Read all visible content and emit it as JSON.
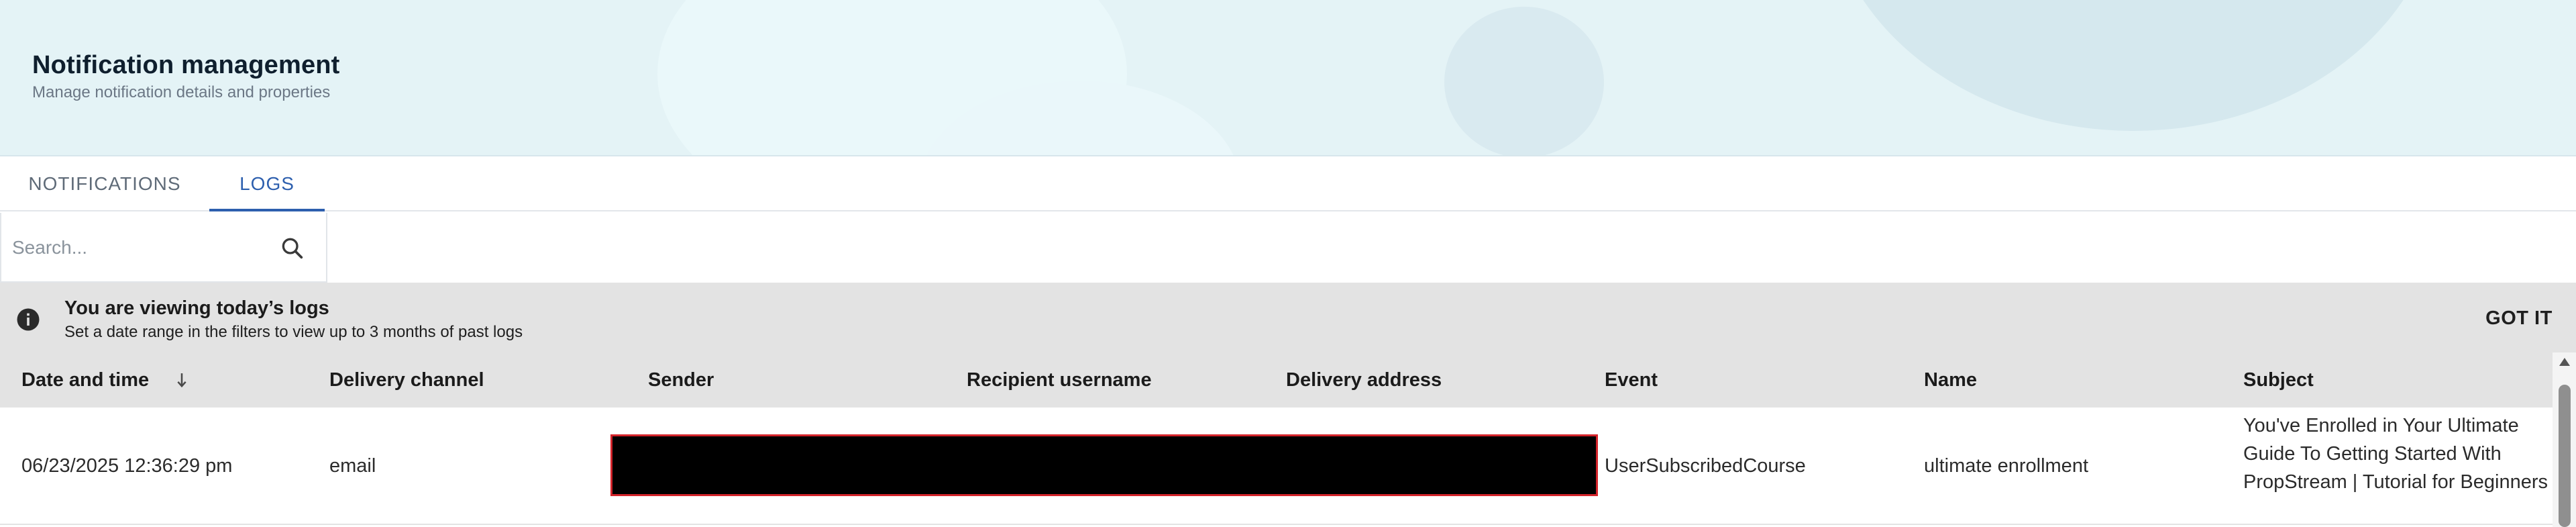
{
  "header": {
    "title": "Notification management",
    "subtitle": "Manage notification details and properties"
  },
  "tabs": [
    {
      "label": "NOTIFICATIONS",
      "active": false
    },
    {
      "label": "LOGS",
      "active": true
    }
  ],
  "search": {
    "placeholder": "Search...",
    "value": "",
    "icon": "search-icon"
  },
  "info_banner": {
    "icon": "info-icon",
    "title": "You are viewing today’s logs",
    "text": "Set a date range in the filters to view up to 3 months of past logs",
    "action_label": "GOT IT"
  },
  "table": {
    "sort_icon": "arrow-down-icon",
    "columns": [
      "Date and time",
      "Delivery channel",
      "Sender",
      "Recipient username",
      "Delivery address",
      "Event",
      "Name",
      "Subject"
    ],
    "rows": [
      {
        "date_time": "06/23/2025 12:36:29 pm",
        "delivery_channel": "email",
        "event": "UserSubscribedCourse",
        "name": "ultimate enrollment",
        "subject": "You've Enrolled in Your Ultimate Guide To Getting Started With PropStream | Tutorial for Beginners"
      }
    ]
  },
  "colors": {
    "accent": "#2d5fae",
    "banner_bg": "#e4f3f6",
    "redaction_border": "#d4242b"
  }
}
